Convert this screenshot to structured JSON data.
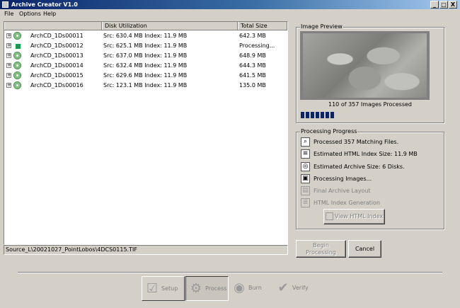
{
  "window": {
    "title": "Archive Creator V1.0",
    "controls": [
      "_",
      "□",
      "X"
    ]
  },
  "menu": [
    "File",
    "Options",
    "Help"
  ],
  "list": {
    "columns": [
      "",
      "Disk Utilization",
      "Total Size"
    ],
    "rows": [
      {
        "name": "ArchCD_1Ds00011",
        "util": "Src: 630.4 MB  Index: 11.9 MB",
        "size": "642.3 MB",
        "icon": "cd-disc-icon"
      },
      {
        "name": "ArchCD_1Ds00012",
        "util": "Src: 625.1 MB  Index: 11.9 MB",
        "size": "Processing...",
        "icon": "processing-icon"
      },
      {
        "name": "ArchCD_1Ds00013",
        "util": "Src: 637.0 MB  Index: 11.9 MB",
        "size": "648.9 MB",
        "icon": "cd-disc-icon"
      },
      {
        "name": "ArchCD_1Ds00014",
        "util": "Src: 632.4 MB  Index: 11.9 MB",
        "size": "644.3 MB",
        "icon": "cd-disc-icon"
      },
      {
        "name": "ArchCD_1Ds00015",
        "util": "Src: 629.6 MB  Index: 11.9 MB",
        "size": "641.5 MB",
        "icon": "cd-disc-icon"
      },
      {
        "name": "ArchCD_1Ds00016",
        "util": "Src: 123.1 MB  Index: 11.9 MB",
        "size": "135.0 MB",
        "icon": "cd-disc-icon"
      }
    ]
  },
  "status_path": "Source_L\\20021027_PointLobos\\4DCS0115.TIF",
  "preview": {
    "label": "Image Preview",
    "caption": "110 of 357 Images Processed",
    "progress_fraction": 0.31
  },
  "processing": {
    "label": "Processing Progress",
    "steps": [
      {
        "text": "Processed 357 Matching Files.",
        "icon": "magnifier-icon",
        "done": true
      },
      {
        "text": "Estimated HTML Index Size: 11.9 MB",
        "icon": "html-page-icon",
        "done": true
      },
      {
        "text": "Estimated Archive Size: 6 Disks.",
        "icon": "disk-stack-icon",
        "done": true
      },
      {
        "text": "Processing Images...",
        "icon": "image-icon",
        "done": true
      },
      {
        "text": "Final Archive Layout",
        "icon": "layout-icon",
        "done": false
      },
      {
        "text": "HTML Index Generation",
        "icon": "html-gen-icon",
        "done": false
      }
    ],
    "view_index_label": "View HTML Index"
  },
  "buttons": {
    "begin": "Begin\nProcessing",
    "cancel": "Cancel"
  },
  "toolbar": [
    {
      "label": "Setup",
      "icon": "clipboard-check-icon",
      "state": "raised"
    },
    {
      "label": "Process",
      "icon": "gears-icon",
      "state": "pressed"
    },
    {
      "label": "Burn",
      "icon": "cd-burn-icon",
      "state": "flat"
    },
    {
      "label": "Verify",
      "icon": "verify-icon",
      "state": "flat"
    }
  ]
}
